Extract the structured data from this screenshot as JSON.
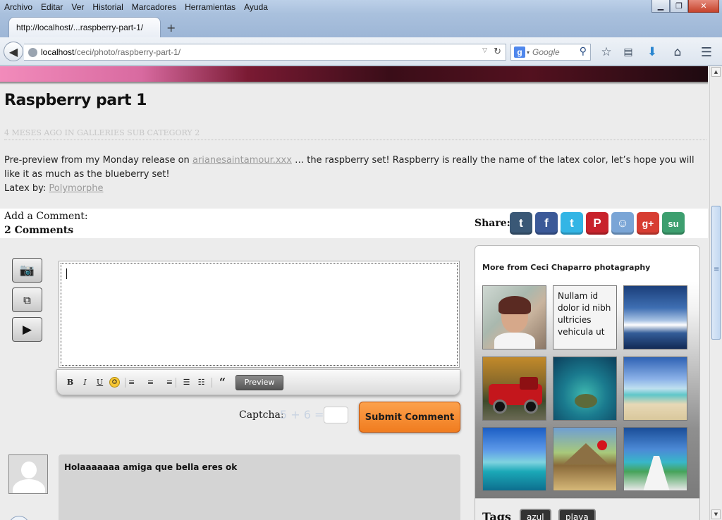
{
  "browser": {
    "menu": [
      "Archivo",
      "Editar",
      "Ver",
      "Historial",
      "Marcadores",
      "Herramientas",
      "Ayuda"
    ],
    "tab_title": "http://localhost/...raspberry-part-1/",
    "url_host": "localhost",
    "url_path": "/ceci/photo/raspberry-part-1/",
    "search_placeholder": "Google"
  },
  "post": {
    "title": "Raspberry part 1",
    "meta_prefix": "4 meses ago in ",
    "meta_category": "Galleries Sub Category 2",
    "body_before_link": "Pre-preview from my Monday release on ",
    "body_link": "arianesaintamour.xxx",
    "body_after_link": " … the raspberry set! Raspberry is really the name of the latex color, let’s hope you will like it as much as the blueberry set!",
    "latex_label": "Latex by: ",
    "latex_link": "Polymorphe"
  },
  "comments": {
    "add_label": "Add a Comment:",
    "count_label": "2 Comments",
    "share_label": "Share:",
    "share_buttons": [
      {
        "name": "tumblr",
        "glyph": "t",
        "color": "#3a5876"
      },
      {
        "name": "facebook",
        "glyph": "f",
        "color": "#3b5998"
      },
      {
        "name": "twitter",
        "glyph": "t",
        "color": "#33b5e5"
      },
      {
        "name": "pinterest",
        "glyph": "P",
        "color": "#c8232c"
      },
      {
        "name": "reddit",
        "glyph": "☺",
        "color": "#7aa5d6"
      },
      {
        "name": "google-plus",
        "glyph": "g+",
        "color": "#d73d32"
      },
      {
        "name": "stumbleupon",
        "glyph": "su",
        "color": "#3d9f6f"
      }
    ],
    "editor_tools": [
      "B",
      "I",
      "U",
      "☺",
      "≡",
      "≡",
      "≡",
      "☰",
      "☷",
      "“"
    ],
    "preview_label": "Preview",
    "captcha_label": "Captcha:",
    "captcha_question": "5 + 6 =",
    "submit_label": "Submit Comment",
    "first_comment_text": "Holaaaaaaa amiga que bella eres ok"
  },
  "widget": {
    "title": "More from Ceci Chaparro photagraphy",
    "text_tile": "Nullam id dolor id nibh ultricies vehicula ut",
    "tags_label": "Tags",
    "tags": [
      "azul",
      "playa"
    ]
  }
}
